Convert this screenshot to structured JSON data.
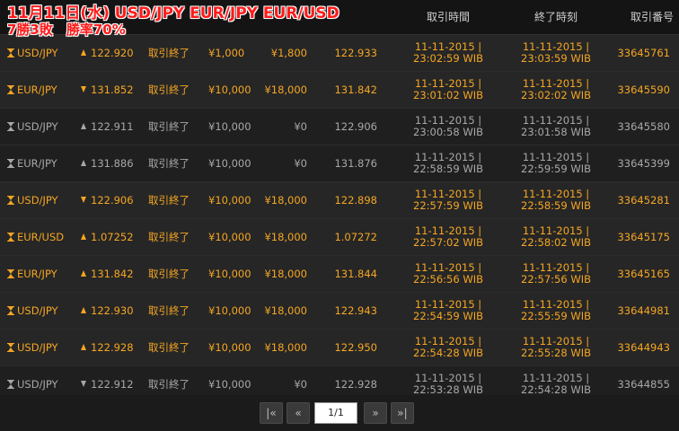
{
  "overlay": {
    "line1": "11月11日(水) USD/JPY EUR/JPY EUR/USD",
    "line2": "7勝3敗　勝率70%"
  },
  "header": {
    "col_start": "取引時間",
    "col_end": "終了時刻",
    "col_id": "取引番号"
  },
  "rows": [
    {
      "result": "win",
      "dir": "up",
      "pair": "USD/JPY",
      "entry": "122.920",
      "status": "取引終了",
      "invest": "¥1,000",
      "payout": "¥1,800",
      "close": "122.933",
      "start_date": "11-11-2015 |",
      "start_time": "23:02:59 WIB",
      "end_date": "11-11-2015 |",
      "end_time": "23:03:59 WIB",
      "id": "33645761"
    },
    {
      "result": "win",
      "dir": "down",
      "pair": "EUR/JPY",
      "entry": "131.852",
      "status": "取引終了",
      "invest": "¥10,000",
      "payout": "¥18,000",
      "close": "131.842",
      "start_date": "11-11-2015 |",
      "start_time": "23:01:02 WIB",
      "end_date": "11-11-2015 |",
      "end_time": "23:02:02 WIB",
      "id": "33645590"
    },
    {
      "result": "tie",
      "dir": "up",
      "pair": "USD/JPY",
      "entry": "122.911",
      "status": "取引終了",
      "invest": "¥10,000",
      "payout": "¥0",
      "close": "122.906",
      "start_date": "11-11-2015 |",
      "start_time": "23:00:58 WIB",
      "end_date": "11-11-2015 |",
      "end_time": "23:01:58 WIB",
      "id": "33645580"
    },
    {
      "result": "tie",
      "dir": "up",
      "pair": "EUR/JPY",
      "entry": "131.886",
      "status": "取引終了",
      "invest": "¥10,000",
      "payout": "¥0",
      "close": "131.876",
      "start_date": "11-11-2015 |",
      "start_time": "22:58:59 WIB",
      "end_date": "11-11-2015 |",
      "end_time": "22:59:59 WIB",
      "id": "33645399"
    },
    {
      "result": "win",
      "dir": "down",
      "pair": "USD/JPY",
      "entry": "122.906",
      "status": "取引終了",
      "invest": "¥10,000",
      "payout": "¥18,000",
      "close": "122.898",
      "start_date": "11-11-2015 |",
      "start_time": "22:57:59 WIB",
      "end_date": "11-11-2015 |",
      "end_time": "22:58:59 WIB",
      "id": "33645281"
    },
    {
      "result": "win",
      "dir": "up",
      "pair": "EUR/USD",
      "entry": "1.07252",
      "status": "取引終了",
      "invest": "¥10,000",
      "payout": "¥18,000",
      "close": "1.07272",
      "start_date": "11-11-2015 |",
      "start_time": "22:57:02 WIB",
      "end_date": "11-11-2015 |",
      "end_time": "22:58:02 WIB",
      "id": "33645175"
    },
    {
      "result": "win",
      "dir": "up",
      "pair": "EUR/JPY",
      "entry": "131.842",
      "status": "取引終了",
      "invest": "¥10,000",
      "payout": "¥18,000",
      "close": "131.844",
      "start_date": "11-11-2015 |",
      "start_time": "22:56:56 WIB",
      "end_date": "11-11-2015 |",
      "end_time": "22:57:56 WIB",
      "id": "33645165"
    },
    {
      "result": "win",
      "dir": "up",
      "pair": "USD/JPY",
      "entry": "122.930",
      "status": "取引終了",
      "invest": "¥10,000",
      "payout": "¥18,000",
      "close": "122.943",
      "start_date": "11-11-2015 |",
      "start_time": "22:54:59 WIB",
      "end_date": "11-11-2015 |",
      "end_time": "22:55:59 WIB",
      "id": "33644981"
    },
    {
      "result": "win",
      "dir": "up",
      "pair": "USD/JPY",
      "entry": "122.928",
      "status": "取引終了",
      "invest": "¥10,000",
      "payout": "¥18,000",
      "close": "122.950",
      "start_date": "11-11-2015 |",
      "start_time": "22:54:28 WIB",
      "end_date": "11-11-2015 |",
      "end_time": "22:55:28 WIB",
      "id": "33644943"
    },
    {
      "result": "tie",
      "dir": "down",
      "pair": "USD/JPY",
      "entry": "122.912",
      "status": "取引終了",
      "invest": "¥10,000",
      "payout": "¥0",
      "close": "122.928",
      "start_date": "11-11-2015 |",
      "start_time": "22:53:28 WIB",
      "end_date": "11-11-2015 |",
      "end_time": "22:54:28 WIB",
      "id": "33644855"
    }
  ],
  "pager": {
    "first": "|«",
    "prev": "«",
    "page": "1/1",
    "next": "»",
    "last": "»|"
  }
}
